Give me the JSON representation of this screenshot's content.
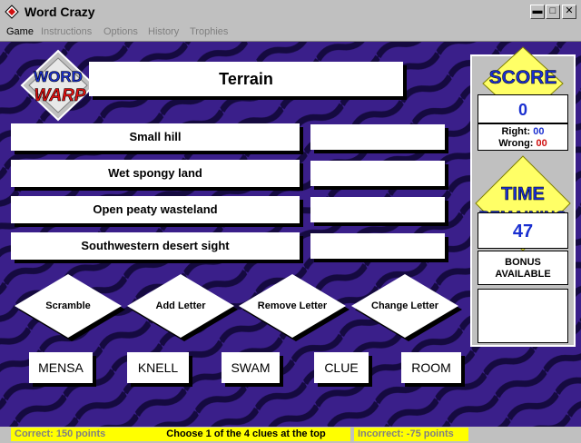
{
  "window": {
    "title": "Word Crazy"
  },
  "menu": [
    "Game",
    "Instructions",
    "Options",
    "History",
    "Trophies"
  ],
  "logo": {
    "line1": "WORD",
    "line2": "WARP"
  },
  "category": "Terrain",
  "clues": [
    "Small hill",
    "Wet spongy land",
    "Open peaty wasteland",
    "Southwestern desert sight"
  ],
  "actions": [
    "Scramble",
    "Add Letter",
    "Remove Letter",
    "Change Letter"
  ],
  "words": [
    "MENSA",
    "KNELL",
    "SWAM",
    "CLUE",
    "ROOM"
  ],
  "score": {
    "heading": "SCORE",
    "value": "0",
    "right_label": "Right:",
    "right_value": "00",
    "wrong_label": "Wrong:",
    "wrong_value": "00"
  },
  "time": {
    "heading_line1": "TIME",
    "heading_line2": "REMAINING",
    "value": "47",
    "bonus_line1": "BONUS",
    "bonus_line2": "AVAILABLE"
  },
  "status": {
    "correct": "Correct: 150 points",
    "instruction": "Choose 1 of the 4 clues at the top",
    "incorrect": "Incorrect: -75 points"
  },
  "colors": {
    "background": "#3a1f8a",
    "stripe": "#150a40",
    "accent_yellow": "#ffff66",
    "score_blue": "#1a2fd0",
    "wrong_red": "#d01010"
  }
}
